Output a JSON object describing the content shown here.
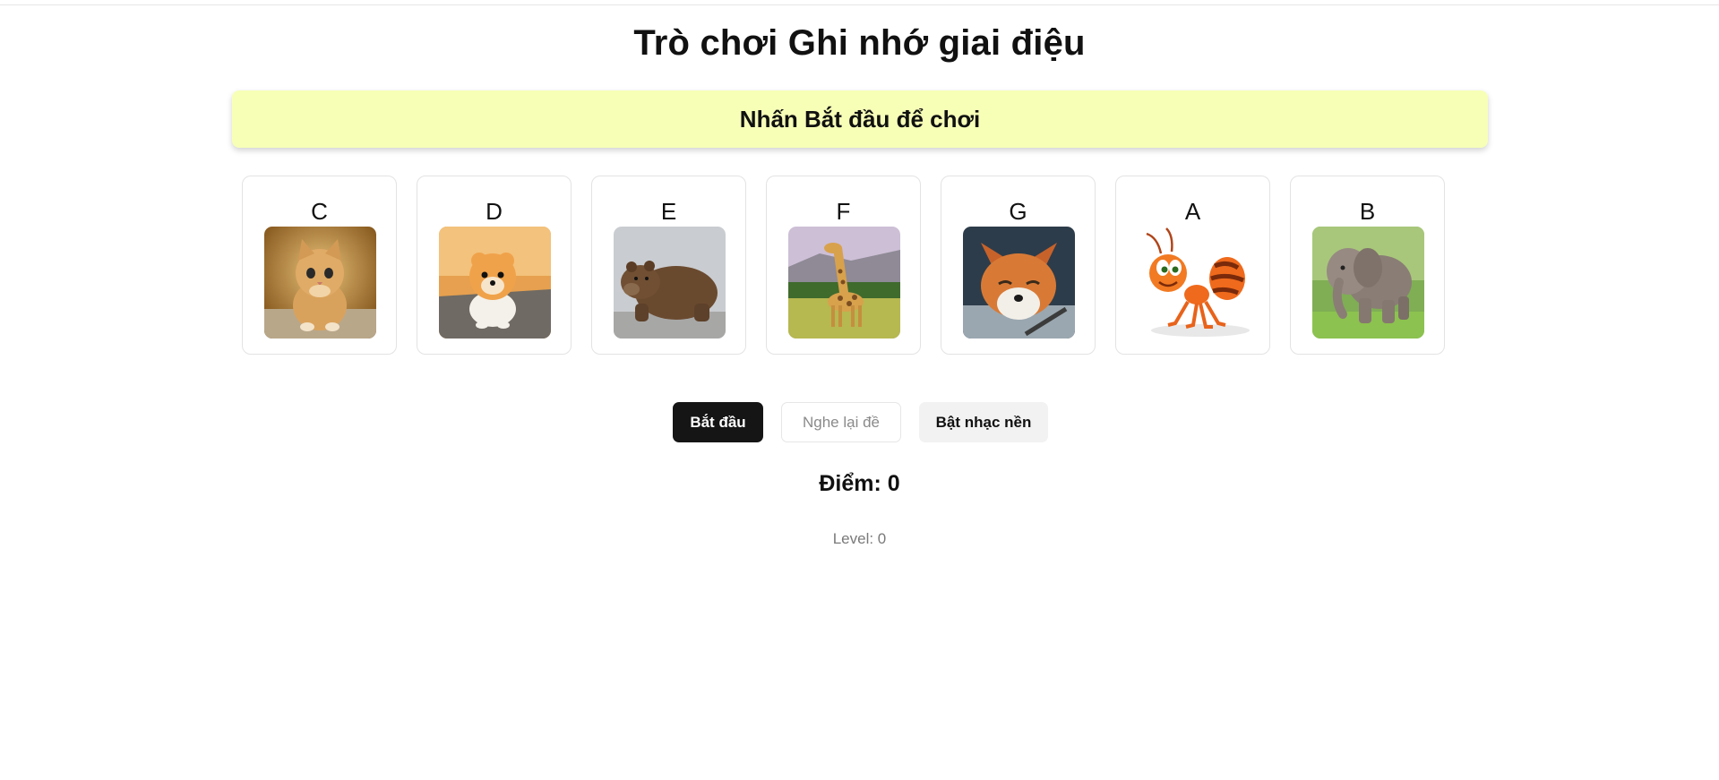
{
  "title": "Trò chơi Ghi nhớ giai điệu",
  "status_message": "Nhấn Bắt đầu để chơi",
  "notes": [
    {
      "note": "C",
      "animal": "kitten"
    },
    {
      "note": "D",
      "animal": "puppy"
    },
    {
      "note": "E",
      "animal": "bear"
    },
    {
      "note": "F",
      "animal": "giraffe"
    },
    {
      "note": "G",
      "animal": "fox"
    },
    {
      "note": "A",
      "animal": "ant"
    },
    {
      "note": "B",
      "animal": "elephant"
    }
  ],
  "controls": {
    "start_label": "Bắt đầu",
    "replay_label": "Nghe lại đề",
    "music_label": "Bật nhạc nền"
  },
  "score_text": "Điểm: 0",
  "level_text": "Level: 0",
  "colors": {
    "banner_bg": "#f7ffb7",
    "start_bg": "#151515",
    "music_bg": "#f2f2f2"
  }
}
